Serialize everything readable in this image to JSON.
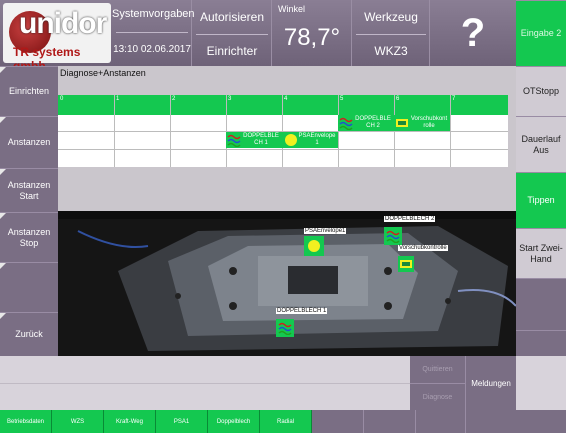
{
  "header": {
    "logo_word": "unidor",
    "logo_sub": "TR systems gmbh",
    "systemvorgaben_label": "Systemvorgaben",
    "datetime": "13:10 02.06.2017",
    "autorisieren_label": "Autorisieren",
    "user_role": "Einrichter",
    "winkel_label": "Winkel",
    "winkel_value": "78,7°",
    "werkzeug_label": "Werkzeug",
    "werkzeug_value": "WKZ3",
    "help_symbol": "?"
  },
  "left_menu": [
    "Einrichten",
    "Anstanzen",
    "Anstanzen Start",
    "Anstanzen Stop",
    "Zurück"
  ],
  "right_menu": [
    "Eingabe 2",
    "OTStopp",
    "Dauerlauf Aus",
    "Tippen",
    "Start Zwei-Hand"
  ],
  "panel": {
    "title": "Diagnose+Anstanzen",
    "ticks": [
      "0",
      "1",
      "2",
      "3",
      "4",
      "5",
      "6",
      "7"
    ],
    "cells": {
      "doppelblech1": "DOPPELBLE CH 1",
      "psaenvelope": "PSAEnvelope 1",
      "doppelblech2": "DOPPELBLE CH 2",
      "vorschub": "Vorschubkont rolle"
    }
  },
  "camera_labels": {
    "psa": "PSAEnvelope1",
    "db2": "DOPPELBLECH 2",
    "vorschub": "Vorschubkontrolle",
    "db1": "DOPPELBLECH 1"
  },
  "bottom_actions": {
    "quittieren": "Quittieren",
    "diagnose": "Diagnose",
    "meldungen": "Meldungen"
  },
  "bottom_tabs": [
    "Betriebsdaten",
    "WZS",
    "Kraft-Weg",
    "PSA1",
    "Doppelblech",
    "Radial"
  ],
  "colors": {
    "accent_green": "#14c850",
    "menu_purple": "#7a6e84",
    "brand_red": "#b01818"
  }
}
